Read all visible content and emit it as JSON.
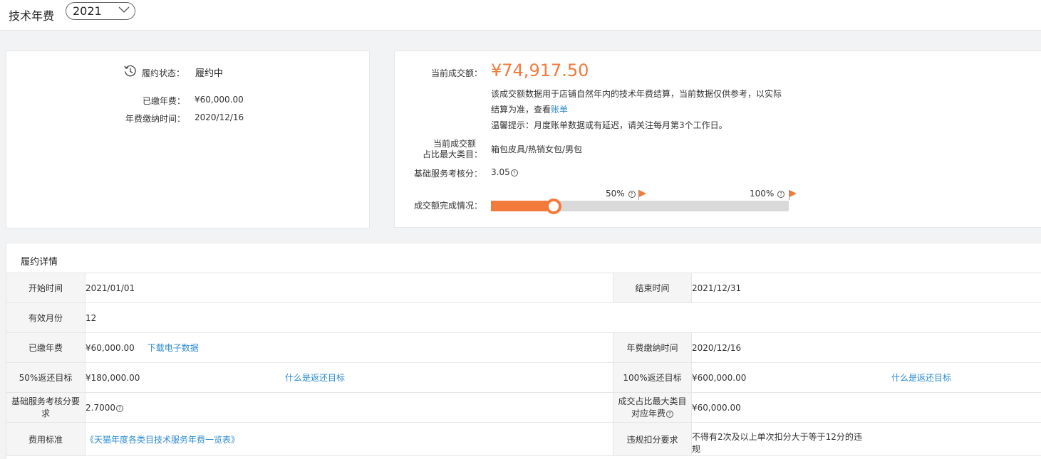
{
  "header": {
    "title": "技术年费",
    "year": "2021"
  },
  "contract_card": {
    "status_label": "履约状态：",
    "status_value": "履约中",
    "paid_label": "已缴年费：",
    "paid_value": "¥60,000.00",
    "paytime_label": "年费缴纳时间：",
    "paytime_value": "2020/12/16"
  },
  "sales_card": {
    "amount_label": "当前成交额：",
    "amount_value": "¥74,917.50",
    "desc_line1": "该成交额数据用于店铺自然年内的技术年费结算，当前数据仅供参考，以实际",
    "desc_line2_prefix": "结算为准，查看",
    "bill_link": "账单",
    "desc_line3": "温馨提示：月度账单数据或有延迟，请关注每月第3个工作日。",
    "category_label_line1": "当前成交额",
    "category_label_line2": "占比最大类目：",
    "category_value": "箱包皮具/热销女包/男包",
    "score_label": "基础服务考核分：",
    "score_value": "3.05",
    "progress_label": "成交额完成情况：",
    "progress_fraction": 0.21,
    "milestone_50": "50%",
    "milestone_100": "100%"
  },
  "detail": {
    "title": "履约详情",
    "rows": {
      "start_label": "开始时间",
      "start_value": "2021/01/01",
      "end_label": "结束时间",
      "end_value": "2021/12/31",
      "months_label": "有效月份",
      "months_value": "12",
      "paid_label": "已缴年费",
      "paid_value": "¥60,000.00",
      "download_link": "下载电子数据",
      "paytime_label": "年费缴纳时间",
      "paytime_value": "2020/12/16",
      "target50_label": "50%返还目标",
      "target50_value": "¥180,000.00",
      "target50_link": "什么是返还目标",
      "target100_label": "100%返还目标",
      "target100_value": "¥600,000.00",
      "target100_link": "什么是返还目标",
      "score_req_label_line1": "基础服务考核分要",
      "score_req_label_line2": "求",
      "score_req_value": "2.7000",
      "cat_fee_label_line1": "成交占比最大类目",
      "cat_fee_label_line2": "对应年费",
      "cat_fee_value": "¥60,000.00",
      "fee_std_label": "费用标准",
      "fee_std_link": "《天猫年度各类目技术服务年费一览表》",
      "violation_label": "违规扣分要求",
      "violation_value_line1": "不得有2次及以上单次扣分大于等于12分的违",
      "violation_value_line2": "规"
    }
  }
}
